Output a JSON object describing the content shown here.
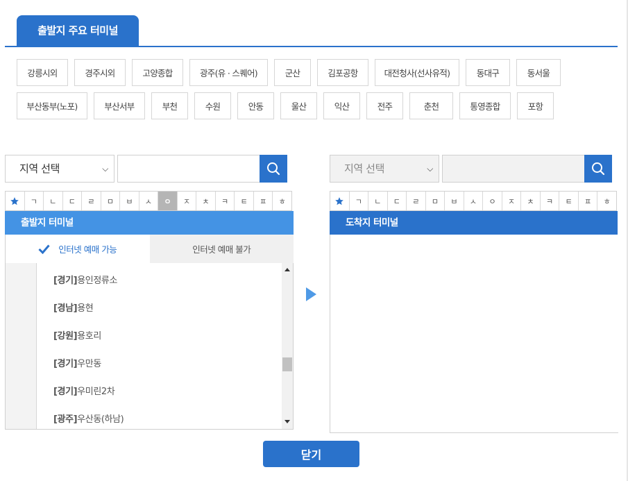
{
  "tab": {
    "title": "출발지 주요 터미널"
  },
  "chips": {
    "row1": [
      "강릉시외",
      "경주시외",
      "고양종합",
      "광주(유 · 스퀘어)",
      "군산",
      "김포공항",
      "대전청사(선사유적)",
      "동대구",
      "동서울"
    ],
    "row2": [
      "부산동부(노포)",
      "부산서부",
      "부천",
      "수원",
      "안동",
      "울산",
      "익산",
      "전주",
      "춘천",
      "통영종합",
      "포항"
    ]
  },
  "departure": {
    "region_select": "지역 선택",
    "search_placeholder": "",
    "consonants": [
      "★",
      "ㄱ",
      "ㄴ",
      "ㄷ",
      "ㄹ",
      "ㅁ",
      "ㅂ",
      "ㅅ",
      "ㅇ",
      "ㅈ",
      "ㅊ",
      "ㅋ",
      "ㅌ",
      "ㅍ",
      "ㅎ"
    ],
    "active_consonant": "ㅇ",
    "header": "출발지 터미널",
    "tab_on": "인터넷 예매 가능",
    "tab_off": "인터넷 예매 불가",
    "items": [
      {
        "region": "[경기]",
        "name": "용인정류소"
      },
      {
        "region": "[경남]",
        "name": "용현"
      },
      {
        "region": "[강원]",
        "name": "용호리"
      },
      {
        "region": "[경기]",
        "name": "우만동"
      },
      {
        "region": "[경기]",
        "name": "우미린2차"
      },
      {
        "region": "[광주]",
        "name": "우산동(하남)"
      }
    ]
  },
  "arrival": {
    "region_select": "지역 선택",
    "consonants": [
      "★",
      "ㄱ",
      "ㄴ",
      "ㄷ",
      "ㄹ",
      "ㅁ",
      "ㅂ",
      "ㅅ",
      "ㅇ",
      "ㅈ",
      "ㅊ",
      "ㅋ",
      "ㅌ",
      "ㅍ",
      "ㅎ"
    ],
    "header": "도착지 터미널"
  },
  "close_label": "닫기",
  "colors": {
    "primary": "#2a72cb",
    "header_light": "#4493e4"
  }
}
